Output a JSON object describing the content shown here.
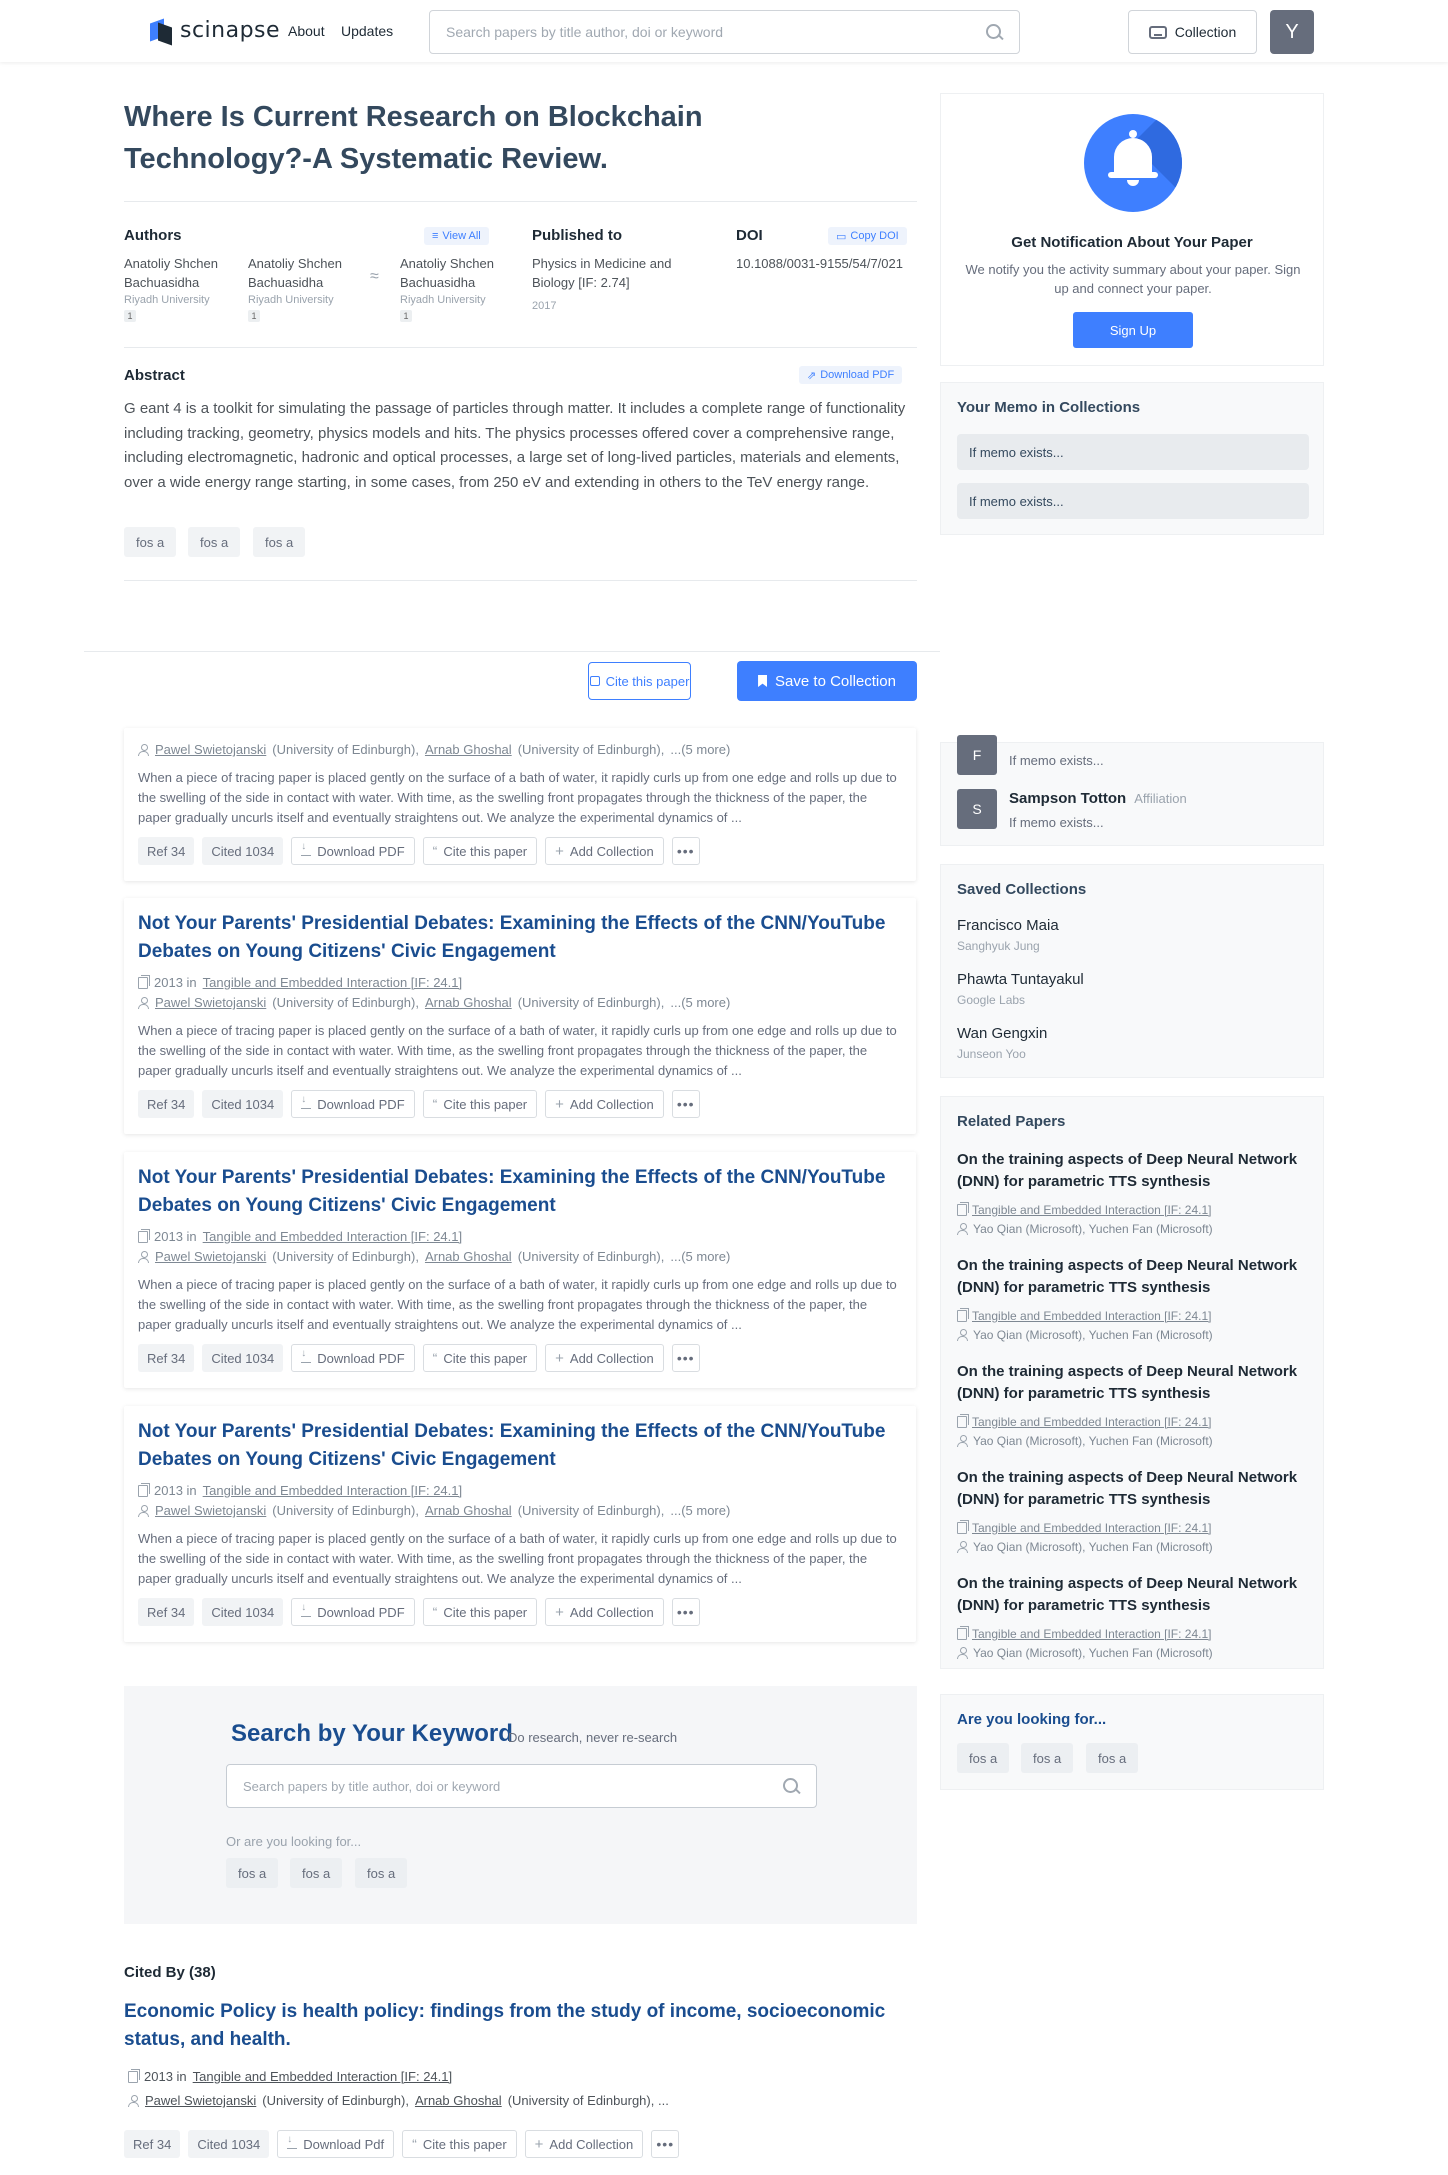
{
  "header": {
    "logo_text": "scinapse",
    "nav": [
      "About",
      "Updates"
    ],
    "search_placeholder": "Search papers by title author, doi or keyword",
    "collection_label": "Collection",
    "user_initial": "Y"
  },
  "paper": {
    "title": "Where Is Current Research on Blockchain Technology?-A Systematic Review.",
    "authors_label": "Authors",
    "view_all": "View All",
    "authors": [
      {
        "name": "Anatoliy Shchen Bachuasidha",
        "affiliation": "Riyadh University",
        "hindex": "1"
      },
      {
        "name": "Anatoliy Shchen Bachuasidha",
        "affiliation": "Riyadh University",
        "hindex": "1"
      },
      {
        "name": "Anatoliy Shchen Bachuasidha",
        "affiliation": "Riyadh University",
        "hindex": "1"
      }
    ],
    "published_label": "Published to",
    "journal": "Physics in Medicine and Biology [IF: 2.74]",
    "year": "2017",
    "doi_label": "DOI",
    "copy_doi": "Copy DOI",
    "doi": "10.1088/0031-9155/54/7/021",
    "abstract_label": "Abstract",
    "download_pdf": "Download PDF",
    "abstract": "G eant 4 is a toolkit for simulating the passage of particles through matter. It includes a complete range of functionality including tracking, geometry, physics models and hits. The physics processes offered cover a comprehensive range, including electromagnetic, hadronic and optical processes, a large set of long-lived particles, materials and elements, over a wide energy range starting, in some cases, from 250 eV and extending in others to the TeV energy range.",
    "tags": [
      "fos a",
      "fos a",
      "fos a"
    ],
    "cite_btn": "Cite this paper",
    "save_btn": "Save to Collection"
  },
  "refs": {
    "first_authors": {
      "a1": "Pawel Swietojanski",
      "a1_aff": "(University of Edinburgh),",
      "a2": "Arnab Ghoshal",
      "a2_aff": "(University of Edinburgh),",
      "more": "...(5 more)"
    },
    "abstract": "When a piece of tracing paper is placed gently on the surface of a bath of water, it rapidly curls up from one edge and rolls up due to the swelling of the side in contact with water. With time, as the swelling front propagates through the thickness of the paper, the paper gradually uncurls itself and eventually straightens out. We analyze the experimental dynamics of ...",
    "title": "Not Your Parents' Presidential Debates: Examining the Effects of the CNN/YouTube Debates on Young Citizens' Civic Engagement",
    "year_in": "2013 in",
    "venue": "Tangible and Embedded Interaction [IF: 24.1]",
    "ref": "Ref 34",
    "cited": "Cited 1034",
    "download": "Download PDF",
    "cite": "Cite this paper",
    "add": "Add Collection"
  },
  "keyword": {
    "title": "Search by Your Keyword",
    "subtitle": "Do research, never re-search",
    "placeholder": "Search papers by title author, doi or keyword",
    "or_label": "Or are you looking for...",
    "tags": [
      "fos a",
      "fos a",
      "fos a"
    ]
  },
  "cited_by": {
    "label": "Cited By (38)",
    "title": "Economic Policy is health policy: findings from the study of income, socioeconomic status, and health.",
    "year_in": "2013 in",
    "venue": "Tangible and Embedded Interaction [IF: 24.1]",
    "a1": "Pawel Swietojanski",
    "a1_aff": "(University of Edinburgh),",
    "a2": "Arnab Ghoshal",
    "a2_aff": "(University of Edinburgh), ...",
    "ref": "Ref 34",
    "cited": "Cited 1034",
    "download": "Download Pdf",
    "cite": "Cite this paper",
    "add": "Add Collection"
  },
  "sidebar": {
    "notif_title": "Get Notification About Your Paper",
    "notif_desc": "We notify you the activity summary about your paper. Sign up and connect your paper.",
    "signup": "Sign Up",
    "memo_title": "Your Memo in Collections",
    "memo_rows": [
      "If memo exists...",
      "If memo exists..."
    ],
    "members": [
      {
        "initial": "F",
        "memo": "If memo exists..."
      },
      {
        "initial": "S",
        "name": "Sampson Totton",
        "aff": "Affiliation",
        "memo": "If memo exists..."
      }
    ],
    "saved_title": "Saved Collections",
    "saved": [
      {
        "name": "Francisco Maia",
        "owner": "Sanghyuk Jung"
      },
      {
        "name": "Phawta Tuntayakul",
        "owner": "Google Labs"
      },
      {
        "name": "Wan Gengxin",
        "owner": "Junseon Yoo"
      }
    ],
    "related_title": "Related Papers",
    "related": {
      "title": "On the training aspects of Deep Neural Network (DNN) for parametric TTS synthesis",
      "venue": "Tangible and Embedded Interaction [IF: 24.1]",
      "authors": "Yao Qian (Microsoft), Yuchen Fan (Microsoft)"
    },
    "looking_title": "Are you looking for...",
    "looking_tags": [
      "fos a",
      "fos a",
      "fos a"
    ]
  },
  "colors": {
    "accent": "#3e7fff",
    "title_blue": "#1a4d8f",
    "text": "#1e2a35"
  }
}
